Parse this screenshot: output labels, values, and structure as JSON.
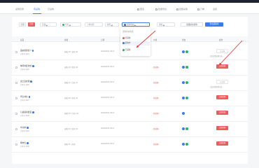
{
  "nav": {
    "tabs": [
      "采购目录",
      "待采购",
      "已采购"
    ],
    "actions": [
      "更多",
      "批量导出",
      "批量采购",
      "订单",
      "设置"
    ]
  },
  "filters": {
    "btn_all": "全部",
    "btn_active": "待办",
    "shop_label": "店铺",
    "warehouse": "仓库",
    "time_placeholder": "下单时间",
    "type_label": "类型",
    "status_selected": "采购状态",
    "keyword_label": "搜索",
    "confirm_button": "批量提交采购",
    "search_button": "查询采购单"
  },
  "dropdown": {
    "header": "采购状态筛选",
    "items": [
      "待采购",
      "采购中",
      "已采购"
    ],
    "colors": [
      "#ea5d5d",
      "#3f7be8",
      "#26b46b"
    ]
  },
  "table": {
    "headers": [
      "商品",
      "规格",
      "日期",
      "价格",
      "状态",
      "操作"
    ],
    "rows": [
      {
        "name": "运动鞋款式 T",
        "sub": "订单号 1024",
        "sku": "规格 25 / 蓝色 36",
        "date": "2019/03/21 06:47",
        "price": "",
        "icons": 2,
        "action": "已采购",
        "action_style": "light",
        "note": "点此查看采购记录"
      },
      {
        "name": "休闲外套款式",
        "sub": "订单号 1025",
        "sku": "规格 26 / 黑色 38",
        "date": "2019/03/21 06:47",
        "price": "待采购",
        "icons": 2,
        "action": "立即采购",
        "action_style": "red",
        "note": ""
      },
      {
        "name": "女士连衣裙",
        "sub": "订单号 1026",
        "sku": "规格 27 / 白色 37",
        "date": "2019/03/21 06:47",
        "price": "待采购",
        "icons": 2,
        "action": "已采购",
        "action_style": "light",
        "note": "点此查看采购记录"
      },
      {
        "name": "男士衬衫",
        "sub": "订单号 1027",
        "sku": "规格 28 / 灰色 40",
        "date": "2019/03/21 06:47",
        "price": "待采购",
        "icons": 2,
        "action": "立即采购",
        "action_style": "red",
        "note": ""
      },
      {
        "name": "儿童运动套装",
        "sub": "订单号 1028",
        "sku": "规格 29 / 红色 110",
        "date": "2019/03/21 06:47",
        "price": "待采购",
        "icons": 1,
        "action": "立即采购",
        "action_style": "red",
        "note": ""
      },
      {
        "name": "牛仔裤",
        "sub": "订单号 1029",
        "sku": "规格 30 / 蓝色 32",
        "date": "2019/03/21 06:47",
        "price": "待采购",
        "icons": 2,
        "action": "立即采购",
        "action_style": "red",
        "note": ""
      },
      {
        "name": "帆布包",
        "sub": "订单号 1030",
        "sku": "规格 31 / 米色",
        "date": "2019/03/21 06:47",
        "price": "待采购",
        "icons": 2,
        "action": "立即采购",
        "action_style": "red",
        "note": ""
      }
    ]
  },
  "annotation_color": "#e03b3b"
}
